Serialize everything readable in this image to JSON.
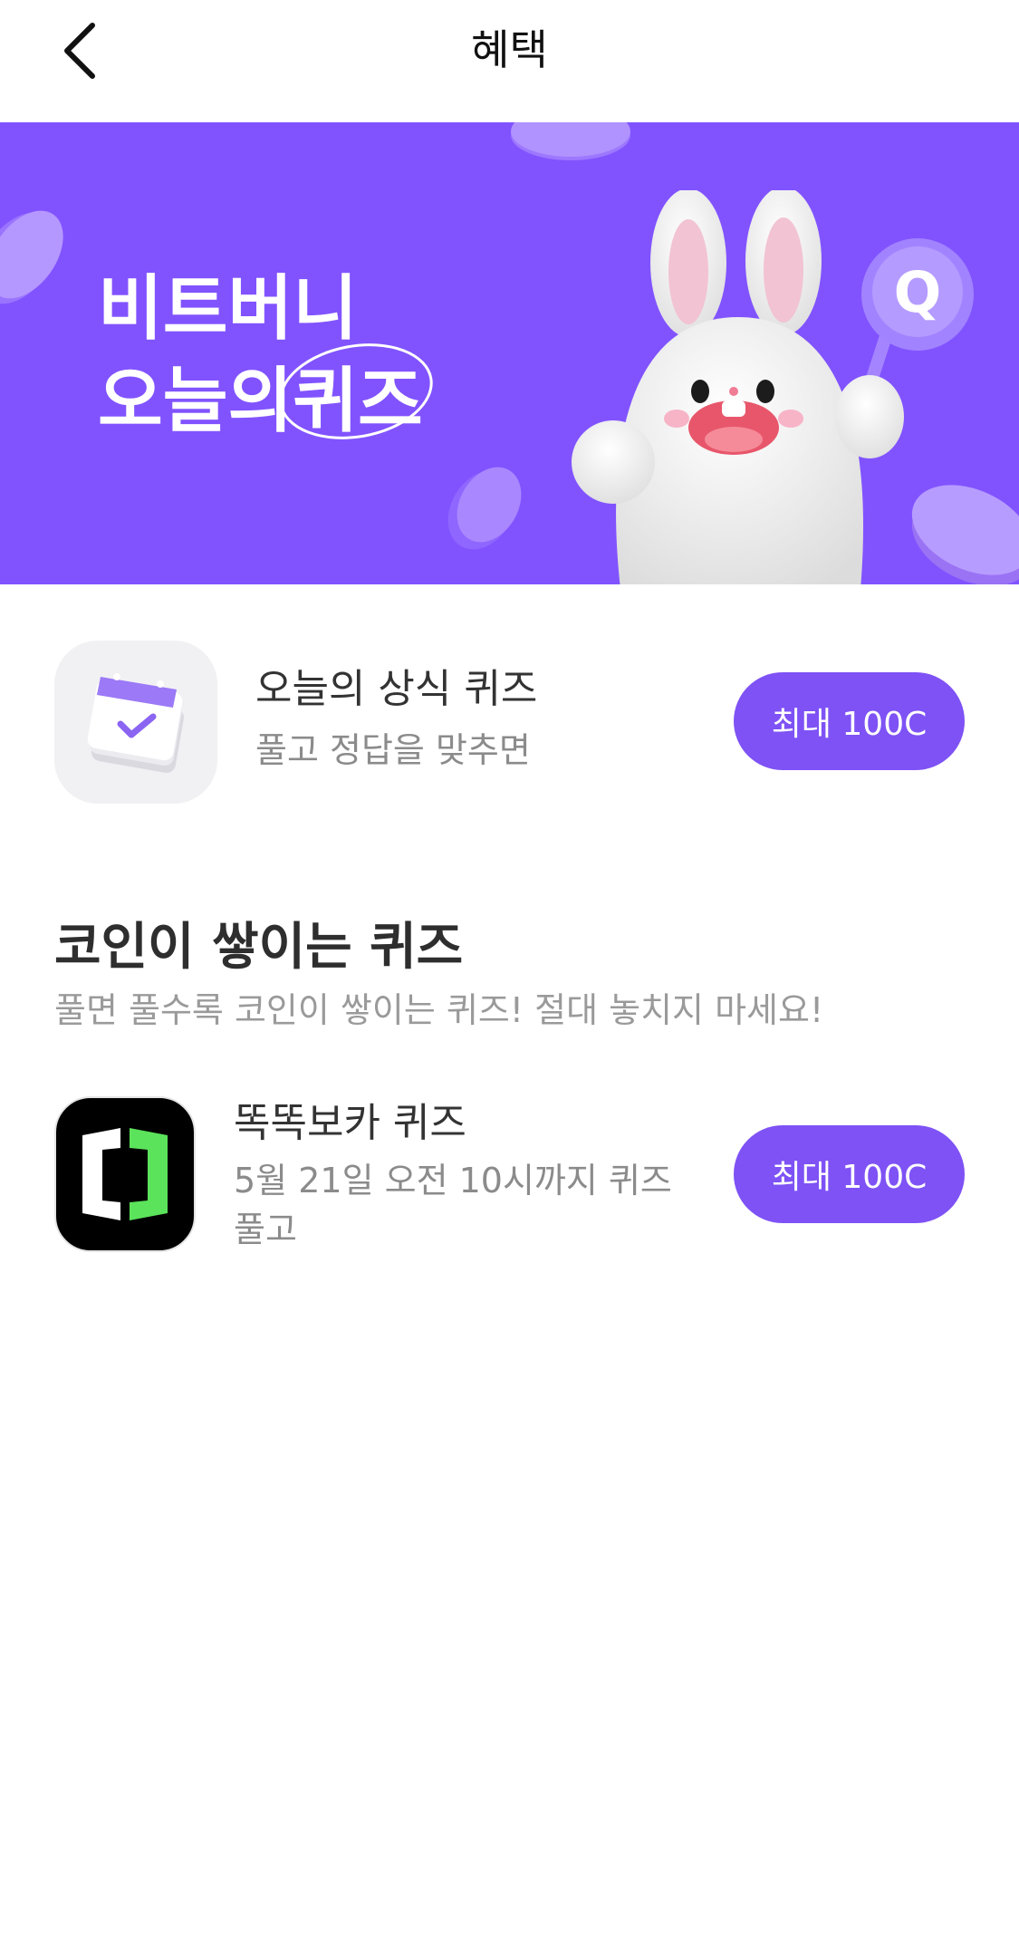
{
  "header": {
    "title": "혜택",
    "back_icon": "chevron-left-icon"
  },
  "banner": {
    "title_line1": "비트버니",
    "title_line2_prefix": "오늘의",
    "title_line2_circled": "퀴즈",
    "background_color": "#8153FF",
    "mascot_sign_letter": "Q"
  },
  "daily_quiz": {
    "icon": "calendar-check-icon",
    "title": "오늘의 상식 퀴즈",
    "subtitle": "풀고 정답을 맞추면",
    "reward_label": "최대 100C"
  },
  "section": {
    "title": "코인이 쌓이는 퀴즈",
    "subtitle": "풀면 풀수록 코인이 쌓이는 퀴즈! 절대 놓치지 마세요!"
  },
  "quiz_list": [
    {
      "icon": "ttokttok-voca-app-icon",
      "title": "똑똑보카 퀴즈",
      "subtitle_line1": "5월 21일 오전 10시까지 퀴즈",
      "subtitle_line2": "풀고",
      "reward_label": "최대 100C"
    }
  ],
  "colors": {
    "accent": "#7E52F5",
    "cc_green": "#5BE35B"
  }
}
